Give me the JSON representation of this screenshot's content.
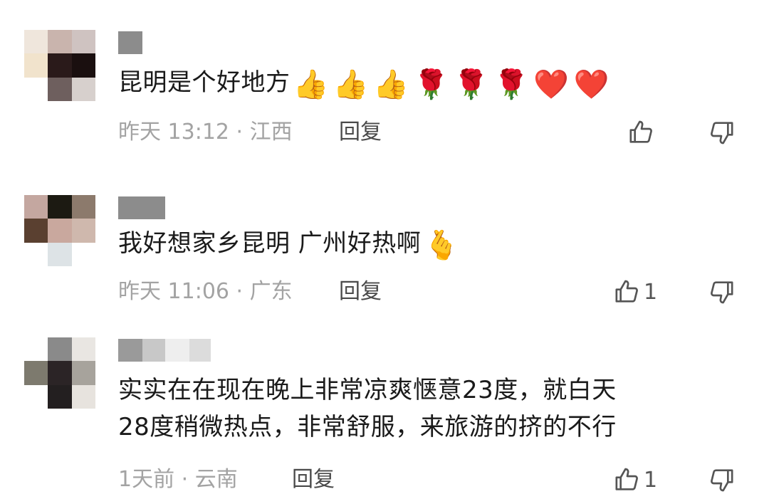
{
  "comments": [
    {
      "text": "昆明是个好地方",
      "emojis": [
        "👍",
        "👍",
        "👍",
        "🌹",
        "🌹",
        "🌹",
        "❤️",
        "❤️"
      ],
      "time": "昨天 13:12 · 江西",
      "reply_label": "回复",
      "likes": ""
    },
    {
      "text": "我好想家乡昆明 广州好热啊",
      "emojis": [
        "🫰"
      ],
      "time": "昨天 11:06 · 广东",
      "reply_label": "回复",
      "likes": "1"
    },
    {
      "text_line1": "实实在在现在晚上非常凉爽惬意23度，就白天",
      "text_line2": "28度稍微热点，非常舒服，来旅游的挤的不行",
      "time": "1天前 · 云南",
      "reply_label": "回复",
      "likes": "1"
    }
  ],
  "icons": {
    "like": "thumbs-up-outline-icon",
    "dislike": "thumbs-down-outline-icon"
  },
  "colors": {
    "text": "#1a1a1a",
    "meta": "#a3a3a3",
    "reply": "#4a4a4a",
    "icon": "#555555"
  }
}
